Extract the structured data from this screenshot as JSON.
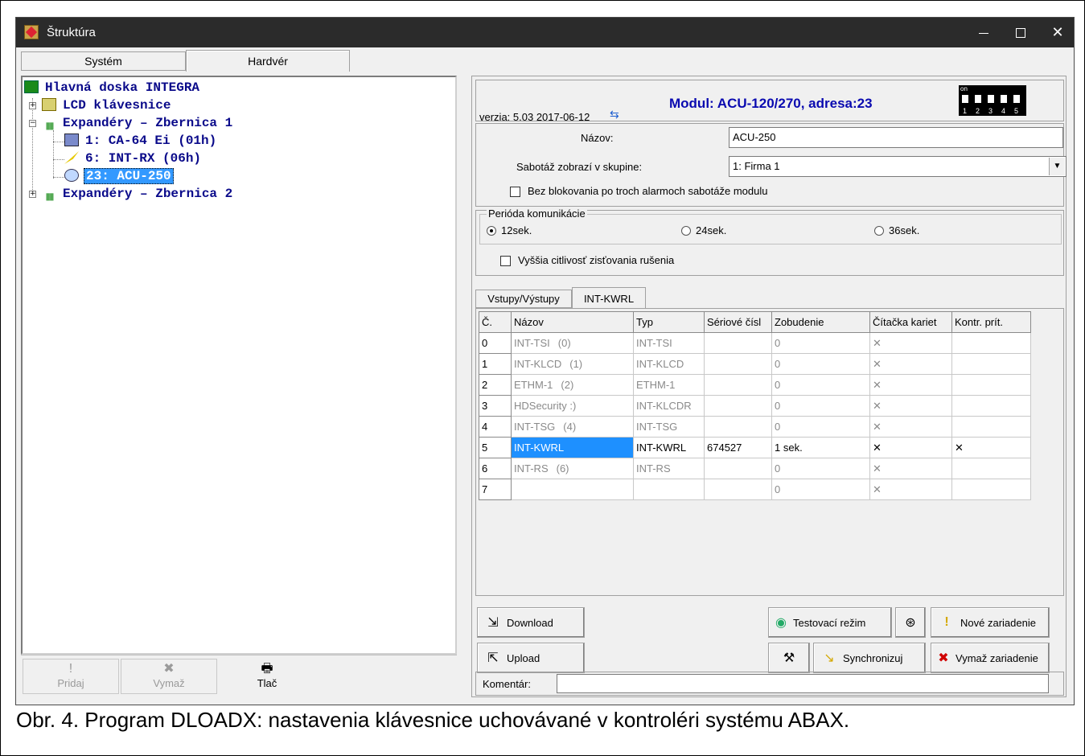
{
  "window": {
    "title": "Štruktúra",
    "minimize": "—",
    "maximize": "",
    "close": "✕"
  },
  "top_tabs": [
    "Systém",
    "Hardvér"
  ],
  "tree": {
    "root": "Hlavná doska INTEGRA",
    "lcd": "LCD klávesnice",
    "bus1": "Expandéry – Zbernica 1",
    "bus1_items": [
      "1:  CA-64 Ei    (01h)",
      "6:  INT-RX      (06h)",
      "23: ACU-250"
    ],
    "bus2": "Expandéry – Zbernica 2"
  },
  "left_buttons": {
    "add": "Pridaj",
    "delete": "Vymaž",
    "print": "Tlač"
  },
  "header": {
    "version": "verzia: 5.03 2017-06-12",
    "module_title": "Modul: ACU-120/270, adresa:23",
    "dip_on": "on",
    "dip_numbers": [
      "1",
      "2",
      "3",
      "4",
      "5"
    ]
  },
  "form": {
    "name_label": "Názov:",
    "name_value": "ACU-250",
    "tamper_label": "Sabotáž zobrazí v skupine:",
    "tamper_value": "1: Firma 1",
    "no_block_label": "Bez blokovania po troch alarmoch sabotáže modulu",
    "no_block_checked": false
  },
  "period": {
    "label": "Perióda komunikácie",
    "options": [
      "12sek.",
      "24sek.",
      "36sek."
    ],
    "selected": "12sek.",
    "sensitivity_label": "Vyššia citlivosť zisťovania rušenia",
    "sensitivity_checked": false
  },
  "inner_tabs": [
    "Vstupy/Výstupy",
    "INT-KWRL"
  ],
  "grid": {
    "headers": [
      "Č.",
      "Názov",
      "Typ",
      "Sériové čísl",
      "Zobudenie",
      "Čítačka kariet",
      "Kontr. prít."
    ],
    "rows": [
      {
        "idx": "0",
        "name": "INT-TSI",
        "sub": "(0)",
        "type": "INT-TSI",
        "serial": "",
        "wake": "0",
        "reader": "✕",
        "presence": ""
      },
      {
        "idx": "1",
        "name": "INT-KLCD",
        "sub": "(1)",
        "type": "INT-KLCD",
        "serial": "",
        "wake": "0",
        "reader": "✕",
        "presence": ""
      },
      {
        "idx": "2",
        "name": "ETHM-1",
        "sub": "(2)",
        "type": "ETHM-1",
        "serial": "",
        "wake": "0",
        "reader": "✕",
        "presence": ""
      },
      {
        "idx": "3",
        "name": "HDSecurity :)",
        "sub": "",
        "type": "INT-KLCDR",
        "serial": "",
        "wake": "0",
        "reader": "✕",
        "presence": ""
      },
      {
        "idx": "4",
        "name": "INT-TSG",
        "sub": "(4)",
        "type": "INT-TSG",
        "serial": "",
        "wake": "0",
        "reader": "✕",
        "presence": ""
      },
      {
        "idx": "5",
        "name": "INT-KWRL",
        "sub": "",
        "type": "INT-KWRL",
        "serial": "674527",
        "wake": "1 sek.",
        "reader": "✕",
        "presence": "✕"
      },
      {
        "idx": "6",
        "name": "INT-RS",
        "sub": "(6)",
        "type": "INT-RS",
        "serial": "",
        "wake": "0",
        "reader": "✕",
        "presence": ""
      },
      {
        "idx": "7",
        "name": "",
        "sub": "",
        "type": "",
        "serial": "",
        "wake": "0",
        "reader": "✕",
        "presence": ""
      }
    ]
  },
  "buttons": {
    "download": "Download",
    "upload": "Upload",
    "test_mode": "Testovací režim",
    "synchronize": "Synchronizuj",
    "new_device": "Nové zariadenie",
    "delete_device": "Vymaž zariadenie"
  },
  "comment": {
    "label": "Komentár:",
    "value": ""
  },
  "caption": "Obr. 4. Program DLOADX: nastavenia klávesnice uchovávané v kontroléri systému ABAX."
}
